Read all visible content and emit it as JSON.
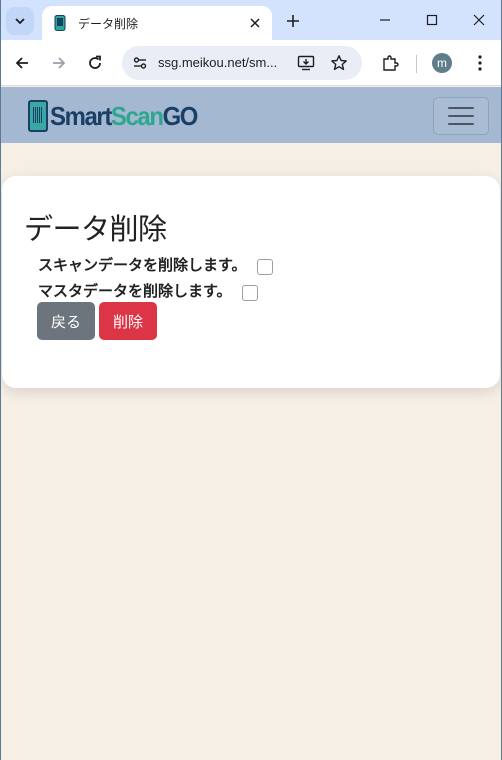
{
  "browser": {
    "tab_title": "データ削除",
    "url": "ssg.meikou.net/sm...",
    "profile_initial": "m"
  },
  "site": {
    "logo_smart": "Smart",
    "logo_scan": "Scan",
    "logo_go": "GO"
  },
  "page": {
    "title": "データ削除",
    "options": [
      {
        "label": "スキャンデータを削除します。",
        "checked": false
      },
      {
        "label": "マスタデータを削除します。",
        "checked": false
      }
    ],
    "buttons": {
      "back": "戻る",
      "delete": "削除"
    }
  },
  "colors": {
    "navbar": "#a4b8d1",
    "page_background": "#f6efe5",
    "back_button": "#6c757d",
    "delete_button": "#dc3545"
  }
}
